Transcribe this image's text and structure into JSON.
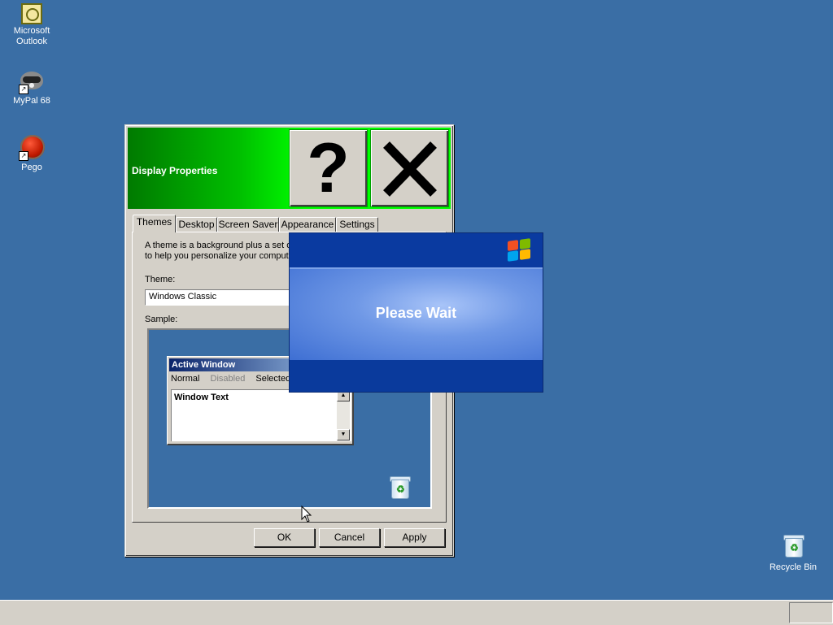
{
  "desktop": {
    "icons": [
      {
        "label_line1": "Microsoft",
        "label_line2": "Outlook"
      },
      {
        "label": "MyPal 68"
      },
      {
        "label": "Pego"
      },
      {
        "label": "Recycle Bin"
      }
    ],
    "background": "#3a6ea5"
  },
  "window": {
    "title": "Display Properties",
    "help_glyph": "?",
    "tabs": [
      {
        "label": "Themes",
        "active": true
      },
      {
        "label": "Desktop"
      },
      {
        "label": "Screen Saver"
      },
      {
        "label": "Appearance"
      },
      {
        "label": "Settings"
      }
    ],
    "description_line1": "A theme is a background plus a set of",
    "description_line2": "to help you personalize your computer",
    "theme_label": "Theme:",
    "theme_value": "Windows Classic",
    "sample_label": "Sample:",
    "sample": {
      "window_title": "Active Window",
      "menu": [
        "Normal",
        "Disabled",
        "Selected"
      ],
      "window_text": "Window Text"
    },
    "buttons": {
      "ok": "OK",
      "cancel": "Cancel",
      "apply": "Apply"
    }
  },
  "please_wait": {
    "message": "Please Wait"
  },
  "colors": {
    "titlebar_start": "#007a00",
    "titlebar_end": "#00ff00",
    "wait_blue": "#0a3a9c"
  }
}
